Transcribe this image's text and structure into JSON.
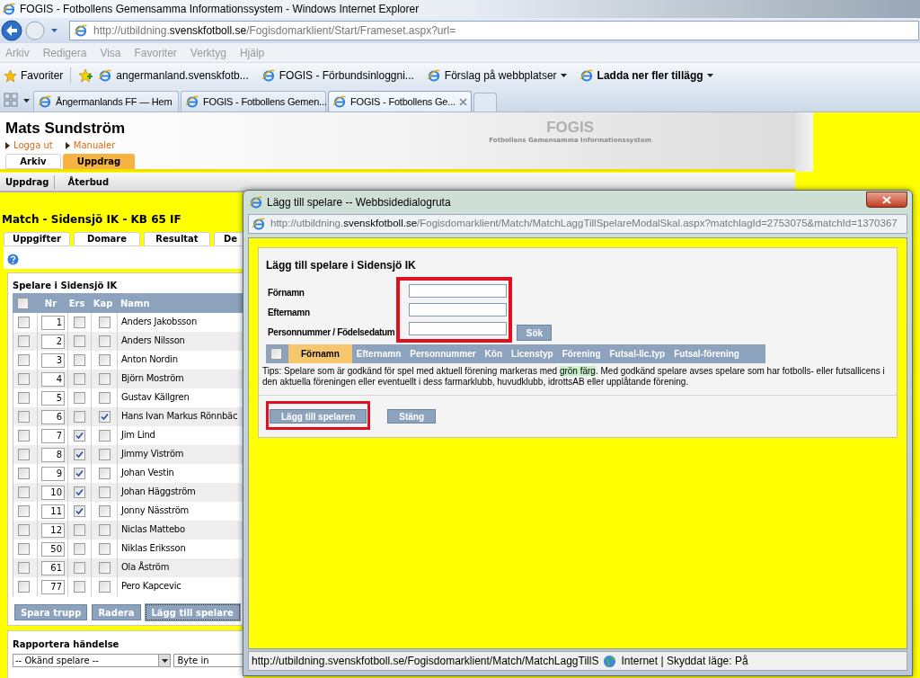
{
  "browser": {
    "title": "FOGIS - Fotbollens Gemensamma Informationssystem - Windows Internet Explorer",
    "address": "http://utbildning.**svenskfotboll.se**/Fogisdomarklient/Start/Frameset.aspx?url=",
    "menu": [
      "Arkiv",
      "Redigera",
      "Visa",
      "Favoriter",
      "Verktyg",
      "Hjälp"
    ],
    "favorites_label": "Favoriter",
    "favorites": [
      {
        "label": "angermanland.svenskfotb...",
        "dropdown": false,
        "bold": false
      },
      {
        "label": "FOGIS - Förbundsinloggni...",
        "dropdown": false,
        "bold": false
      },
      {
        "label": "Förslag på webbplatser",
        "dropdown": true,
        "bold": false
      },
      {
        "label": "Ladda ner fler tillägg",
        "dropdown": true,
        "bold": true
      }
    ],
    "tabs": [
      {
        "label": "Ångermanlands FF — Hem",
        "selected": false
      },
      {
        "label": "FOGIS - Fotbollens Gemen...",
        "selected": false
      },
      {
        "label": "FOGIS - Fotbollens Ge...",
        "selected": true
      }
    ]
  },
  "header": {
    "user": "Mats Sundström",
    "links": [
      "Logga ut",
      "Manualer"
    ],
    "tabs": [
      {
        "label": "Arkiv",
        "selected": false
      },
      {
        "label": "Uppdrag",
        "selected": true
      }
    ],
    "logo": "FOGIS",
    "logo_subtitle": "Fotbollens Gemensamma Informationssystem"
  },
  "submenu": [
    "Uppdrag",
    "Återbud"
  ],
  "match": {
    "title": "Match - Sidensjö IK - KB 65 IF",
    "tabs": [
      "Uppgifter",
      "Domare",
      "Resultat",
      "De"
    ]
  },
  "squad": {
    "title": "Spelare i Sidensjö IK",
    "all_checked": false,
    "columns": [
      "Nr",
      "Ers",
      "Kap",
      "Namn"
    ],
    "rows": [
      {
        "checked": false,
        "nr": "1",
        "ers": false,
        "kap": false,
        "name": "Anders Jakobsson"
      },
      {
        "checked": false,
        "nr": "2",
        "ers": false,
        "kap": false,
        "name": "Anders Nilsson"
      },
      {
        "checked": false,
        "nr": "3",
        "ers": false,
        "kap": false,
        "name": "Anton Nordin"
      },
      {
        "checked": false,
        "nr": "4",
        "ers": false,
        "kap": false,
        "name": "Björn Moström"
      },
      {
        "checked": false,
        "nr": "5",
        "ers": false,
        "kap": false,
        "name": "Gustav Källgren"
      },
      {
        "checked": false,
        "nr": "6",
        "ers": false,
        "kap": true,
        "name": "Hans Ivan Markus Rönnbäc"
      },
      {
        "checked": false,
        "nr": "7",
        "ers": true,
        "kap": false,
        "name": "Jim Lind"
      },
      {
        "checked": false,
        "nr": "8",
        "ers": true,
        "kap": false,
        "name": "Jimmy Viström"
      },
      {
        "checked": false,
        "nr": "9",
        "ers": true,
        "kap": false,
        "name": "Johan Vestin"
      },
      {
        "checked": false,
        "nr": "10",
        "ers": true,
        "kap": false,
        "name": "Johan Häggström"
      },
      {
        "checked": false,
        "nr": "11",
        "ers": true,
        "kap": false,
        "name": "Jonny Näsström"
      },
      {
        "checked": false,
        "nr": "12",
        "ers": false,
        "kap": false,
        "name": "Niclas Mattebo"
      },
      {
        "checked": false,
        "nr": "50",
        "ers": false,
        "kap": false,
        "name": "Niklas Eriksson"
      },
      {
        "checked": false,
        "nr": "61",
        "ers": false,
        "kap": false,
        "name": "Ola Åström"
      },
      {
        "checked": false,
        "nr": "77",
        "ers": false,
        "kap": false,
        "name": "Pero Kapcevic"
      }
    ],
    "buttons": [
      {
        "label": "Spara trupp",
        "focused": false
      },
      {
        "label": "Radera",
        "focused": false
      },
      {
        "label": "Lägg till spelare",
        "focused": true
      }
    ]
  },
  "report": {
    "title": "Rapportera händelse",
    "player": "-- Okänd spelare --",
    "event": "Byte in"
  },
  "dialog": {
    "title": "Lägg till spelare -- Webbsidedialogruta",
    "address": "http://utbildning.**svenskfotboll.se**/Fogisdomarklient/Match/MatchLaggTillSpelareModalSkal.aspx?matchlagId=2753075&matchId=1370367",
    "heading": "Lägg till spelare i Sidensjö IK",
    "fields_highlighted": true,
    "fields": [
      {
        "label": "Förnamn"
      },
      {
        "label": "Efternamn"
      },
      {
        "label": "Personnummer / Födelsedatum"
      }
    ],
    "search_button": "Sök",
    "all_checked": false,
    "columns": [
      {
        "label": "Förnamn",
        "selected": true
      },
      {
        "label": "Efternamn",
        "selected": false
      },
      {
        "label": "Personnummer",
        "selected": false
      },
      {
        "label": "Kön",
        "selected": false
      },
      {
        "label": "Licenstyp",
        "selected": false
      },
      {
        "label": "Förening",
        "selected": false
      },
      {
        "label": "Futsal-lic.typ",
        "selected": false
      },
      {
        "label": "Futsal-förening",
        "selected": false
      }
    ],
    "tip": {
      "before": "Tips: Spelare som är godkänd för spel med aktuell förening markeras med ",
      "highlight": "grön färg",
      "after": ". Med godkänd spelare avses spelare som har fotbolls- eller futsallicens i den aktuella föreningen eller eventuellt i dess farmarklubb, huvudklubb, idrottsAB eller upplåtande förening."
    },
    "buttons": [
      {
        "label": "Lägg till spelaren",
        "highlighted": true
      },
      {
        "label": "Stäng",
        "highlighted": false
      }
    ],
    "status": "http://utbildning.svenskfotboll.se/Fogisdomarklient/Match/MatchLaggTillS",
    "zone": "Internet | Skyddat läge: På"
  }
}
